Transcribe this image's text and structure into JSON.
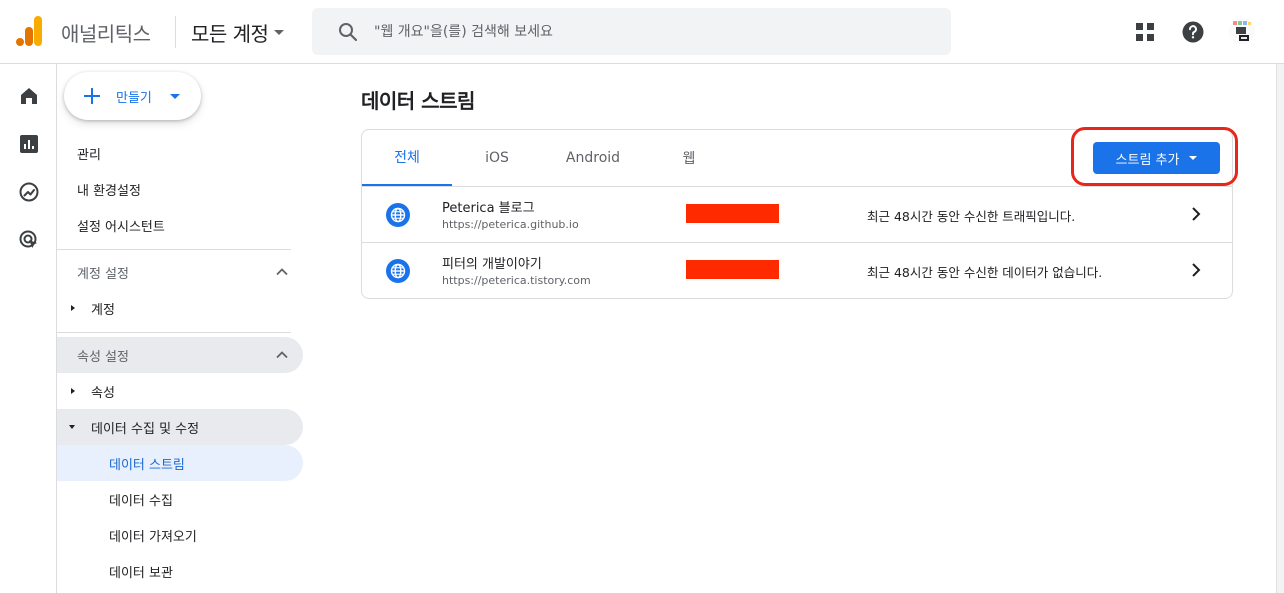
{
  "header": {
    "app_name": "애널리틱스",
    "account_selector": "모든 계정",
    "search_placeholder": "\"웹 개요\"을(를) 검색해 보세요"
  },
  "sidebar": {
    "create_label": "만들기",
    "top_items": [
      {
        "label": "관리"
      },
      {
        "label": "내 환경설정"
      },
      {
        "label": "설정 어시스턴트"
      }
    ],
    "account_section": {
      "title": "계정 설정",
      "items": [
        {
          "label": "계정"
        }
      ]
    },
    "property_section": {
      "title": "속성 설정",
      "items": [
        {
          "label": "속성"
        },
        {
          "label": "데이터 수집 및 수정"
        }
      ],
      "sub_items": [
        {
          "label": "데이터 스트림",
          "active": true
        },
        {
          "label": "데이터 수집"
        },
        {
          "label": "데이터 가져오기"
        },
        {
          "label": "데이터 보관"
        }
      ]
    }
  },
  "main": {
    "title": "데이터 스트림",
    "tabs": [
      {
        "label": "전체",
        "selected": true
      },
      {
        "label": "iOS"
      },
      {
        "label": "Android"
      },
      {
        "label": "웹"
      }
    ],
    "add_stream_label": "스트림 추가",
    "streams": [
      {
        "name": "Peterica 블로그",
        "url": "https://peterica.github.io",
        "status": "최근 48시간 동안 수신한 트래픽입니다."
      },
      {
        "name": "피터의 개발이야기",
        "url": "https://peterica.tistory.com",
        "status": "최근 48시간 동안 수신한 데이터가 없습니다."
      }
    ]
  },
  "colors": {
    "accent": "#1a73e8",
    "highlight_ring": "#e8261a",
    "redaction": "#ff2a00"
  }
}
